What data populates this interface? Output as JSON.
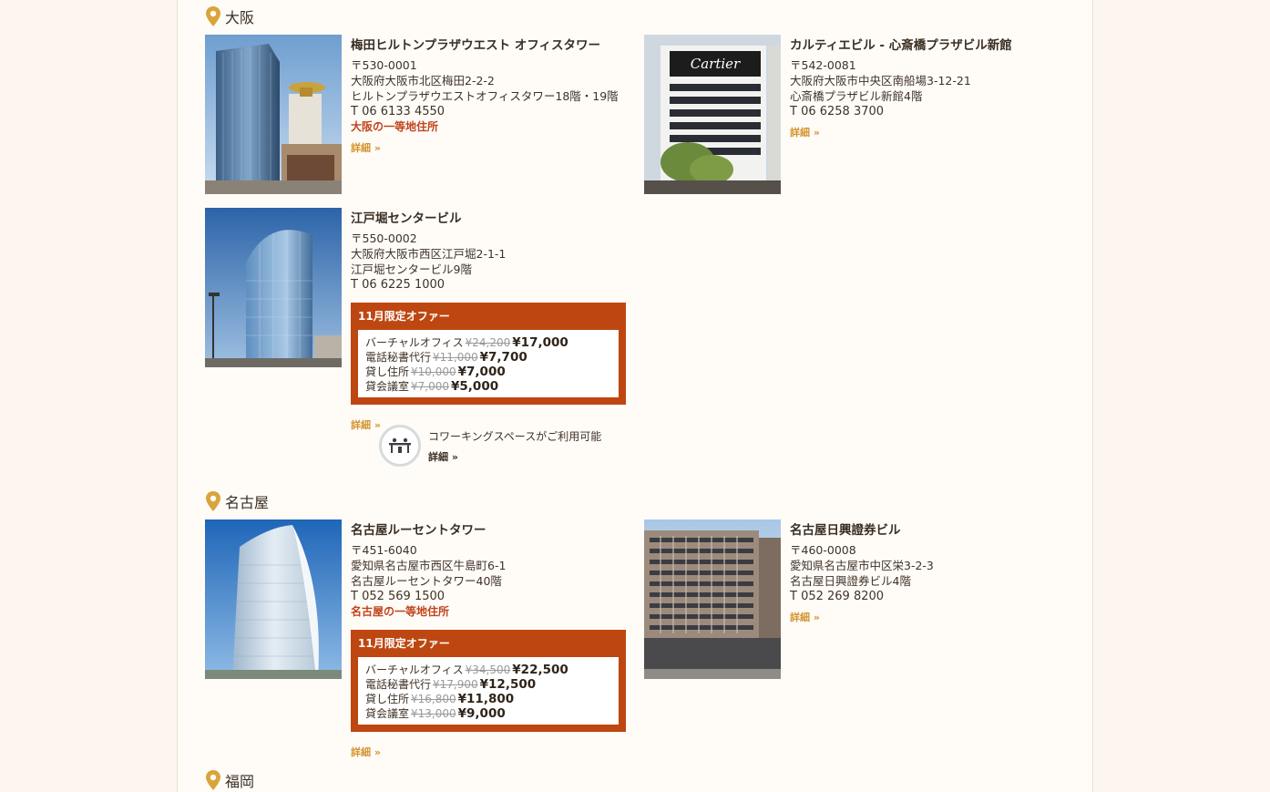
{
  "sections": [
    {
      "city": "大阪",
      "offices": [
        {
          "name": "梅田ヒルトンプラザウエスト オフィスタワー",
          "postal": "〒530-0001",
          "address1": "大阪府大阪市北区梅田2-2-2",
          "address2": "ヒルトンプラザウエストオフィスタワー18階・19階",
          "phone": "T 06 6133 4550",
          "prime": "大阪の一等地住所",
          "detail": "詳細 »"
        },
        {
          "name": "カルティエビル - 心斎橋プラザビル新館",
          "postal": "〒542-0081",
          "address1": "大阪府大阪市中央区南船場3-12-21",
          "address2": "心斎橋プラザビル新館4階",
          "phone": "T 06 6258 3700",
          "detail": "詳細 »",
          "sign": "Cartier"
        },
        {
          "name": "江戸堀センタービル",
          "postal": "〒550-0002",
          "address1": "大阪府大阪市西区江戸堀2-1-1",
          "address2": "江戸堀センタービル9階",
          "phone": "T 06 6225 1000",
          "offer": {
            "title": "11月限定オファー",
            "rows": [
              {
                "label": "バーチャルオフィス",
                "old": "¥24,200",
                "new": "¥17,000"
              },
              {
                "label": "電話秘書代行",
                "old": "¥11,000",
                "new": "¥7,700"
              },
              {
                "label": "貸し住所",
                "old": "¥10,000",
                "new": "¥7,000"
              },
              {
                "label": "貸会議室",
                "old": "¥7,000",
                "new": "¥5,000"
              }
            ]
          },
          "detail": "詳細 »",
          "coworking": {
            "text": "コワーキングスペースがご利用可能",
            "detail": "詳細 »"
          }
        }
      ]
    },
    {
      "city": "名古屋",
      "offices": [
        {
          "name": "名古屋ルーセントタワー",
          "postal": "〒451-6040",
          "address1": "愛知県名古屋市西区牛島町6-1",
          "address2": "名古屋ルーセントタワー40階",
          "phone": "T 052 569 1500",
          "prime": "名古屋の一等地住所",
          "offer": {
            "title": "11月限定オファー",
            "rows": [
              {
                "label": "バーチャルオフィス",
                "old": "¥34,500",
                "new": "¥22,500"
              },
              {
                "label": "電話秘書代行",
                "old": "¥17,900",
                "new": "¥12,500"
              },
              {
                "label": "貸し住所",
                "old": "¥16,800",
                "new": "¥11,800"
              },
              {
                "label": "貸会議室",
                "old": "¥13,000",
                "new": "¥9,000"
              }
            ]
          },
          "detail": "詳細 »"
        },
        {
          "name": "名古屋日興證券ビル",
          "postal": "〒460-0008",
          "address1": "愛知県名古屋市中区栄3-2-3",
          "address2": "名古屋日興證券ビル4階",
          "phone": "T 052 269 8200",
          "detail": "詳細 »"
        }
      ]
    },
    {
      "city": "福岡"
    }
  ],
  "colors": {
    "accent": "#be4711",
    "pin": "#d9a53a",
    "detail_link": "#d4942e",
    "background": "#fcf6ee"
  },
  "icons": {
    "location": "map-pin-icon",
    "coworking": "coworking-desk-icon"
  }
}
